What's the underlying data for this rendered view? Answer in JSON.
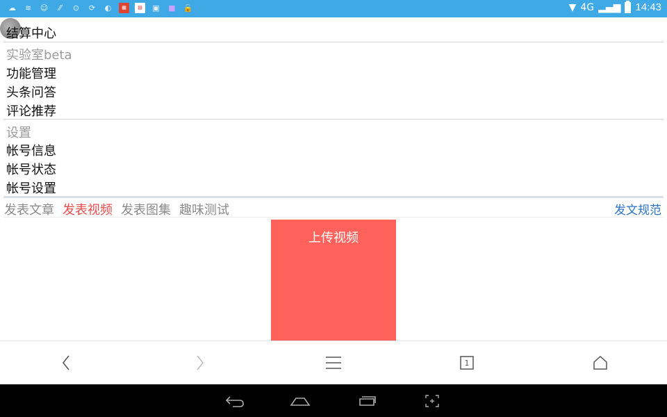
{
  "status_bar": {
    "left_icons": [
      "weather-icon",
      "wifi-app-icon",
      "people-icon",
      "signal-dots-icon",
      "hotspot-icon",
      "sync-icon",
      "eye-icon",
      "news-app-icon",
      "utility-app-icon",
      "gallery-icon",
      "purple-app-icon",
      "lock-icon"
    ],
    "network": "4G",
    "time": "14:43"
  },
  "menu": {
    "top_partial": "结算中心",
    "lab_section": {
      "title": "实验室beta",
      "items": [
        "功能管理",
        "头条问答",
        "评论推荐"
      ]
    },
    "settings_section": {
      "title": "设置",
      "items": [
        "帐号信息",
        "帐号状态",
        "帐号设置"
      ]
    }
  },
  "tabs": {
    "items": [
      "发表文章",
      "发表视频",
      "发表图集",
      "趣味测试"
    ],
    "active": "发表视频",
    "right_link": "发文规范"
  },
  "upload": {
    "label": "上传视频"
  },
  "browser_toolbar": {
    "icons": [
      "back-icon",
      "forward-icon",
      "menu-icon",
      "tabs-icon",
      "home-icon"
    ],
    "tab_count": "1"
  },
  "android_nav": {
    "icons": [
      "back-icon",
      "home-icon",
      "recent-apps-icon",
      "screenshot-icon"
    ]
  },
  "colors": {
    "status_bar": "#3fa9e6",
    "active_tab": "#f04a4a",
    "upload_button": "#ff625b",
    "link": "#2a73c8"
  }
}
